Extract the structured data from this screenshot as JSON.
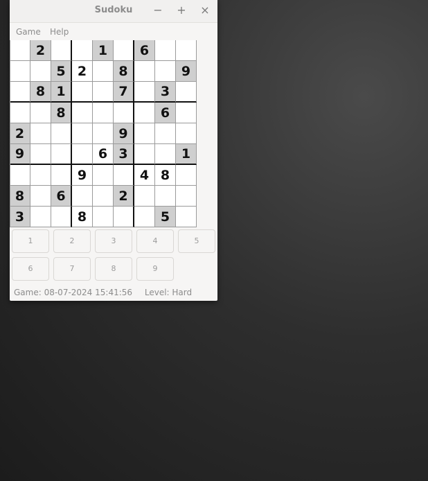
{
  "window": {
    "title": "Sudoku",
    "minimize_label": "−",
    "maximize_label": "+",
    "close_label": "×"
  },
  "menu": [
    "Game",
    "Help"
  ],
  "grid": [
    [
      "",
      "2",
      "",
      "",
      "1",
      "",
      "6",
      "",
      ""
    ],
    [
      "",
      "",
      "5",
      "2",
      "",
      "8",
      "",
      "",
      "9"
    ],
    [
      "",
      "8",
      "1",
      "",
      "",
      "7",
      "",
      "3",
      ""
    ],
    [
      "",
      "",
      "8",
      "",
      "",
      "",
      "",
      "6",
      ""
    ],
    [
      "2",
      "",
      "",
      "",
      "",
      "9",
      "",
      "",
      ""
    ],
    [
      "9",
      "",
      "",
      "",
      "6",
      "3",
      "",
      "",
      "1"
    ],
    [
      "",
      "",
      "",
      "9",
      "",
      "",
      "4",
      "8",
      ""
    ],
    [
      "8",
      "",
      "6",
      "",
      "",
      "2",
      "",
      "",
      ""
    ],
    [
      "3",
      "",
      "",
      "8",
      "",
      "",
      "",
      "5",
      ""
    ]
  ],
  "given_cells": [
    [
      0,
      1
    ],
    [
      0,
      4
    ],
    [
      0,
      6
    ],
    [
      1,
      2
    ],
    [
      1,
      5
    ],
    [
      1,
      8
    ],
    [
      2,
      1
    ],
    [
      2,
      2
    ],
    [
      2,
      5
    ],
    [
      2,
      7
    ],
    [
      3,
      2
    ],
    [
      3,
      7
    ],
    [
      4,
      0
    ],
    [
      4,
      5
    ],
    [
      5,
      0
    ],
    [
      5,
      5
    ],
    [
      5,
      8
    ],
    [
      7,
      0
    ],
    [
      7,
      2
    ],
    [
      7,
      5
    ],
    [
      8,
      0
    ],
    [
      8,
      7
    ]
  ],
  "number_buttons": [
    "1",
    "2",
    "3",
    "4",
    "5",
    "6",
    "7",
    "8",
    "9"
  ],
  "status": {
    "game": "Game: 08-07-2024 15:41:56",
    "level": "Level: Hard"
  },
  "colors": {
    "given_background": "#cfcfcf",
    "desktop_background": "#2a2a2a"
  }
}
